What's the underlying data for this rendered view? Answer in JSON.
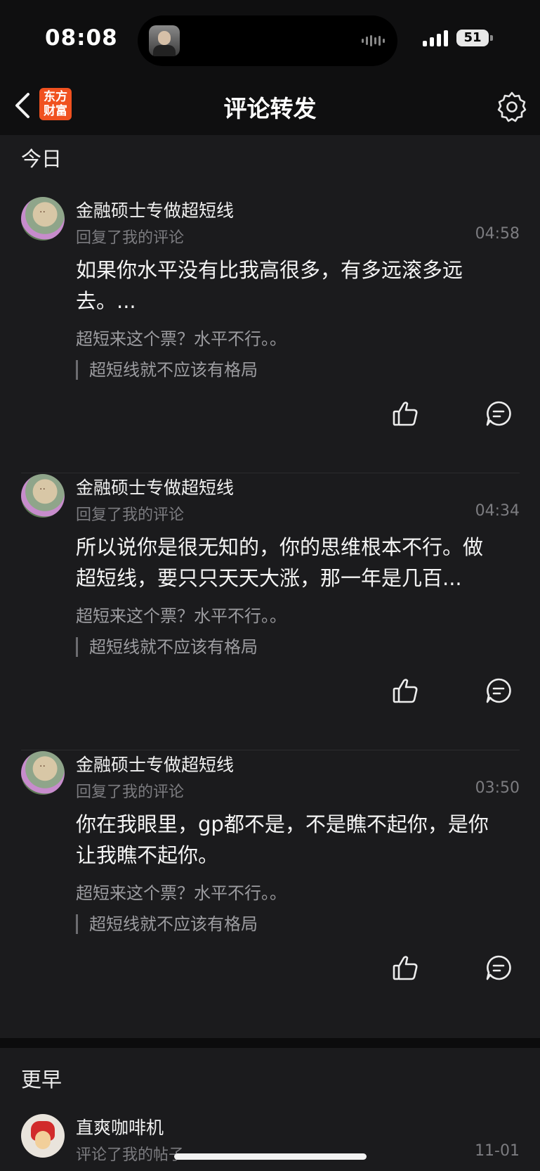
{
  "status": {
    "time": "08:08",
    "battery": "51"
  },
  "nav": {
    "title": "评论转发",
    "logo_text_line1": "东方",
    "logo_text_line2": "财富"
  },
  "today": {
    "label": "今日",
    "items": [
      {
        "user": "金融硕士专做超短线",
        "action": "回复了我的评论",
        "time": "04:58",
        "text": "如果你水平没有比我高很多，有多远滚多远去。...",
        "original": "超短来这个票？水平不行。。",
        "quote": "超短线就不应该有格局"
      },
      {
        "user": "金融硕士专做超短线",
        "action": "回复了我的评论",
        "time": "04:34",
        "text": "所以说你是很无知的，你的思维根本不行。做超短线，要只只天天大涨，那一年是几百...",
        "original": "超短来这个票？水平不行。。",
        "quote": "超短线就不应该有格局"
      },
      {
        "user": "金融硕士专做超短线",
        "action": "回复了我的评论",
        "time": "03:50",
        "text": "你在我眼里，gp都不是，不是瞧不起你，是你让我瞧不起你。",
        "original": "超短来这个票？水平不行。。",
        "quote": "超短线就不应该有格局"
      }
    ]
  },
  "earlier": {
    "label": "更早",
    "items": [
      {
        "user": "直爽咖啡机",
        "action": "评论了我的帖子",
        "time": "11-01"
      }
    ]
  },
  "icons": {
    "back": "chevron-left-icon",
    "settings": "gear-icon",
    "like": "thumbs-up-icon",
    "reply": "comment-bubble-icon"
  }
}
